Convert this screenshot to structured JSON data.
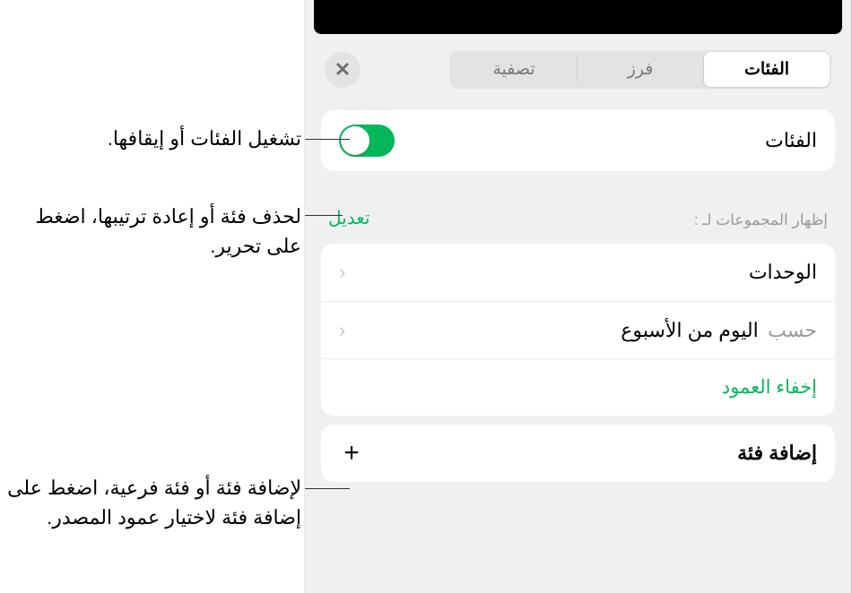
{
  "tabs": {
    "categories": "الفئات",
    "sort": "فرز",
    "filter": "تصفية"
  },
  "categories_row": {
    "label": "الفئات"
  },
  "groups_header": {
    "label": "إظهار المجموعات لـ :",
    "edit": "تعديل"
  },
  "group_rows": {
    "units": "الوحدات",
    "by_prefix": "حسب",
    "by_value": "اليوم من الأسبوع",
    "hide_column": "إخفاء العمود"
  },
  "add_row": {
    "label": "إضافة فئة"
  },
  "callouts": {
    "toggle": "تشغيل الفئات أو إيقافها.",
    "edit": "لحذف فئة أو إعادة ترتيبها، اضغط على تحرير.",
    "add": "لإضافة فئة أو فئة فرعية، اضغط على إضافة فئة لاختيار عمود المصدر."
  }
}
